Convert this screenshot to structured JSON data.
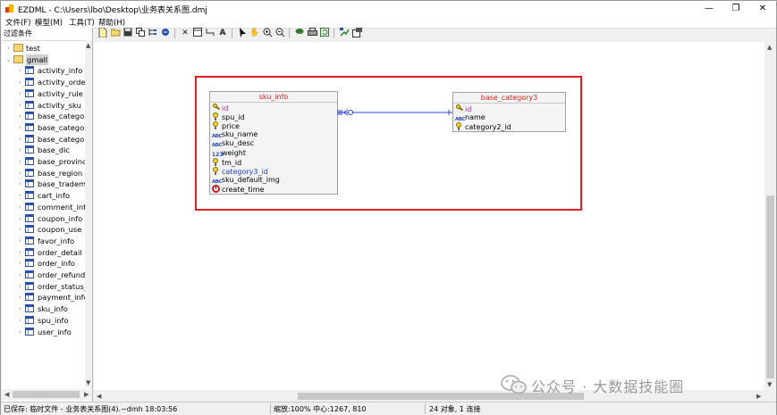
{
  "window": {
    "title": "EZDML - C:\\Users\\lbo\\Desktop\\业务表关系图.dmj",
    "minimize": "—",
    "maximize": "❐",
    "close": "✕"
  },
  "menu": [
    "文件(F)",
    "模型(M)",
    "工具(T)",
    "帮助(H)"
  ],
  "left_panel": {
    "filter_label": "过滤条件",
    "tree": [
      {
        "label": "test",
        "type": "folder",
        "expanded": false
      },
      {
        "label": "gmall",
        "type": "folder",
        "expanded": true
      },
      {
        "label": "activity_info",
        "type": "table"
      },
      {
        "label": "activity_order",
        "type": "table"
      },
      {
        "label": "activity_rule",
        "type": "table"
      },
      {
        "label": "activity_sku",
        "type": "table"
      },
      {
        "label": "base_categor",
        "type": "table"
      },
      {
        "label": "base_categor",
        "type": "table"
      },
      {
        "label": "base_categor",
        "type": "table"
      },
      {
        "label": "base_dic",
        "type": "table"
      },
      {
        "label": "base_provinc",
        "type": "table"
      },
      {
        "label": "base_region",
        "type": "table"
      },
      {
        "label": "base_tradema",
        "type": "table"
      },
      {
        "label": "cart_info",
        "type": "table"
      },
      {
        "label": "comment_info",
        "type": "table"
      },
      {
        "label": "coupon_info",
        "type": "table"
      },
      {
        "label": "coupon_use",
        "type": "table"
      },
      {
        "label": "favor_info",
        "type": "table"
      },
      {
        "label": "order_detail",
        "type": "table"
      },
      {
        "label": "order_info",
        "type": "table"
      },
      {
        "label": "order_refund",
        "type": "table"
      },
      {
        "label": "order_status_",
        "type": "table"
      },
      {
        "label": "payment_info",
        "type": "table"
      },
      {
        "label": "sku_info",
        "type": "table"
      },
      {
        "label": "spu_info",
        "type": "table"
      },
      {
        "label": "user_info",
        "type": "table"
      }
    ]
  },
  "toolbar": {
    "icons": [
      "new-file-icon",
      "open-folder-icon",
      "save-icon",
      "copy-icon",
      "tree-icon",
      "export-icon",
      "delete-icon",
      "table-icon",
      "link-icon",
      "text-icon",
      "pointer-icon",
      "hand-icon",
      "zoom-in-icon",
      "zoom-out-icon",
      "color-icon",
      "print-icon",
      "refresh-icon",
      "generate-icon",
      "settings-icon"
    ]
  },
  "entities": [
    {
      "name": "sku_info",
      "title_color": "#e02020",
      "fields": [
        {
          "name": "id",
          "icon": "key",
          "style": "pk"
        },
        {
          "name": "spu_id",
          "icon": "bulb",
          "style": "normal"
        },
        {
          "name": "price",
          "icon": "bulb",
          "style": "normal"
        },
        {
          "name": "sku_name",
          "icon": "abc",
          "style": "normal"
        },
        {
          "name": "sku_desc",
          "icon": "abc",
          "style": "normal"
        },
        {
          "name": "weight",
          "icon": "num",
          "style": "normal"
        },
        {
          "name": "tm_id",
          "icon": "bulb",
          "style": "normal"
        },
        {
          "name": "category3_id",
          "icon": "bulb",
          "style": "fk"
        },
        {
          "name": "sku_default_img",
          "icon": "abc",
          "style": "normal"
        },
        {
          "name": "create_time",
          "icon": "clock",
          "style": "normal"
        }
      ]
    },
    {
      "name": "base_category3",
      "title_color": "#e02020",
      "fields": [
        {
          "name": "id",
          "icon": "key",
          "style": "pk"
        },
        {
          "name": "name",
          "icon": "abc",
          "style": "normal"
        },
        {
          "name": "category2_id",
          "icon": "bulb",
          "style": "normal"
        }
      ]
    }
  ],
  "relation": {
    "from": "sku_info",
    "to": "base_category3",
    "color": "#2f42e8"
  },
  "status": {
    "saved": "已保存: 临时文件 - 业务表关系图(4).~dmh 18:03:56",
    "zoom": "缩放:100% 中心:1267, 810",
    "counts": "24 对象, 1 连接"
  },
  "watermark": "公众号 · 大数据技能圈"
}
